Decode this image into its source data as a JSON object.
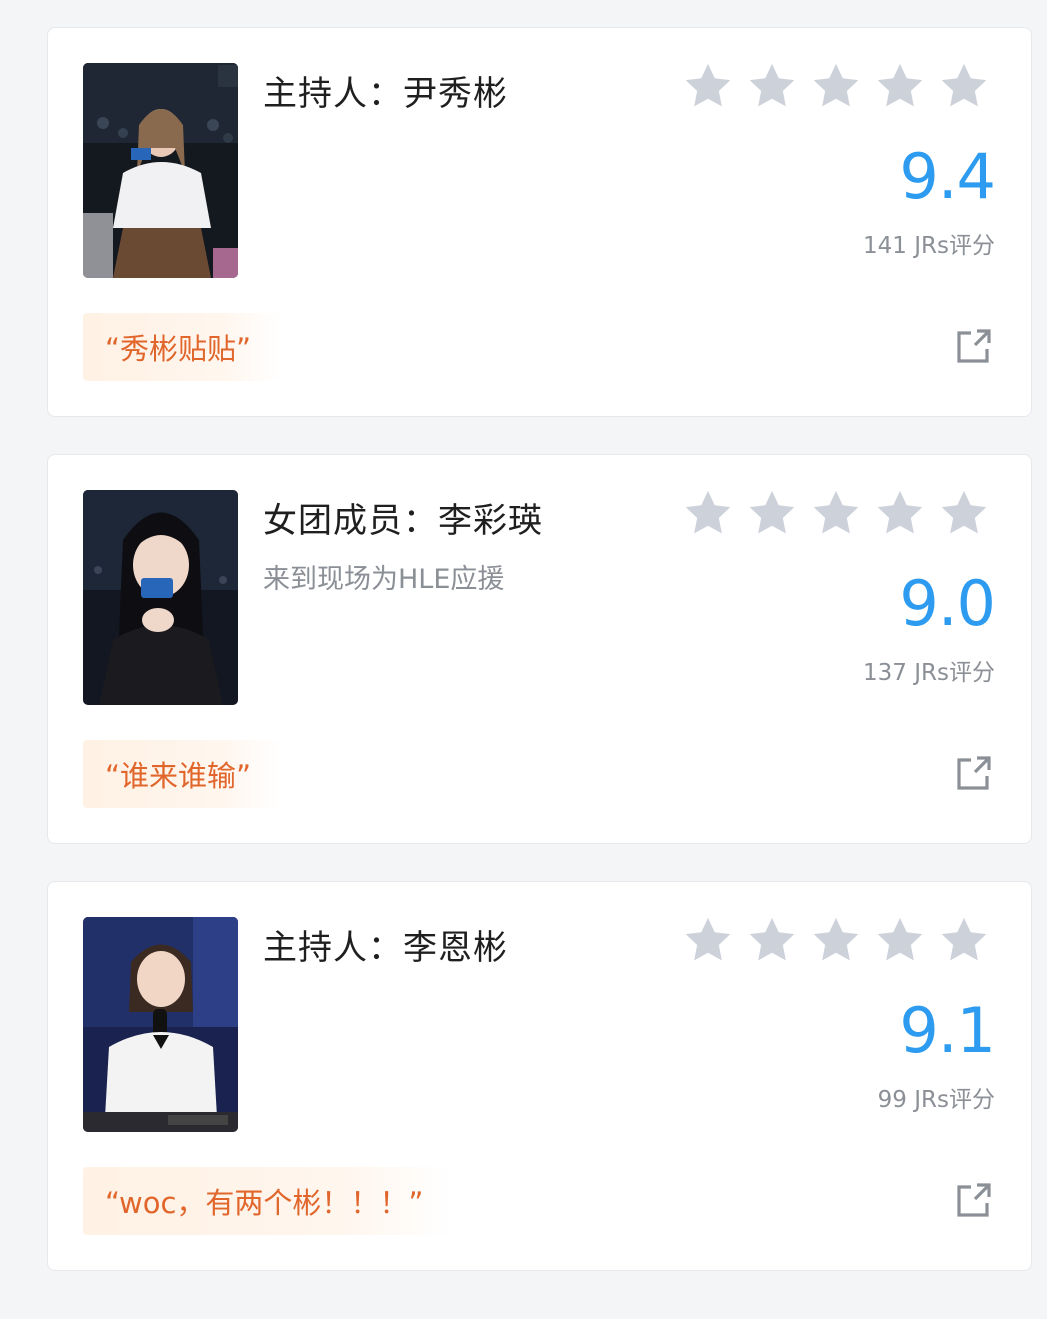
{
  "colors": {
    "accent": "#2d9bf0",
    "quote_text": "#e0662b",
    "star_empty": "#cdd1da",
    "muted": "#8b8f96"
  },
  "cards": [
    {
      "title": "主持人：尹秀彬",
      "subtitle": "",
      "score": "9.4",
      "rating_count": "141 JRs评分",
      "quote": "“秀彬贴贴”",
      "stars_filled": 0,
      "photo": "host-photo",
      "share_icon": "share-external-icon"
    },
    {
      "title": "女团成员：李彩瑛",
      "subtitle": "来到现场为HLE应援",
      "score": "9.0",
      "rating_count": "137 JRs评分",
      "quote": "“谁来谁输”",
      "stars_filled": 0,
      "photo": "member-photo",
      "share_icon": "share-external-icon"
    },
    {
      "title": "主持人：李恩彬",
      "subtitle": "",
      "score": "9.1",
      "rating_count": "99 JRs评分",
      "quote": "“woc，有两个彬！！！”",
      "stars_filled": 0,
      "photo": "host-photo",
      "share_icon": "share-external-icon"
    }
  ]
}
